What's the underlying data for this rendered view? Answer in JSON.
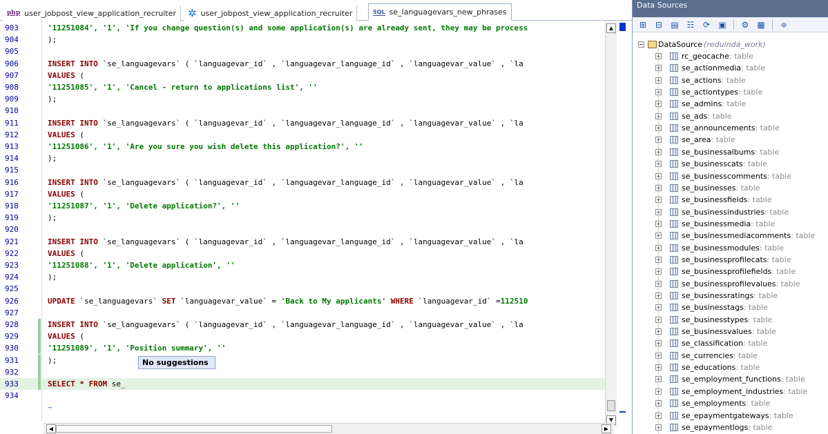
{
  "tabs": [
    {
      "label": "user_jobpost_view_application_recruiter",
      "icon": "php-file-icon",
      "icon_text": "php"
    },
    {
      "label": "user_jobpost_view_application_recruiter",
      "icon": "gear-icon",
      "icon_text": "✲"
    },
    {
      "label": "se_languagevars_new_phrases",
      "icon": "sql-file-icon",
      "icon_text": "SQL"
    }
  ],
  "editor": {
    "lines": [
      {
        "n": "903",
        "tokens": [
          [
            "str",
            "'11251084', '1', 'If you change question(s) and some application(s) are already sent, they may be process"
          ]
        ]
      },
      {
        "n": "904",
        "tokens": [
          [
            "id",
            ");"
          ]
        ]
      },
      {
        "n": "905",
        "tokens": []
      },
      {
        "n": "906",
        "tokens": [
          [
            "kw",
            "INSERT INTO "
          ],
          [
            "id",
            "`se_languagevars` ( `languagevar_id` , `languagevar_language_id` , `languagevar_value` , `la"
          ]
        ]
      },
      {
        "n": "907",
        "tokens": [
          [
            "kw",
            "VALUES "
          ],
          [
            "id",
            "("
          ]
        ]
      },
      {
        "n": "908",
        "tokens": [
          [
            "str",
            "'11251085', '1', 'Cancel - return to applications list', ''"
          ]
        ]
      },
      {
        "n": "909",
        "tokens": [
          [
            "id",
            ");"
          ]
        ]
      },
      {
        "n": "910",
        "tokens": []
      },
      {
        "n": "911",
        "tokens": [
          [
            "kw",
            "INSERT INTO "
          ],
          [
            "id",
            "`se_languagevars` ( `languagevar_id` , `languagevar_language_id` , `languagevar_value` , `la"
          ]
        ]
      },
      {
        "n": "912",
        "tokens": [
          [
            "kw",
            "VALUES "
          ],
          [
            "id",
            "("
          ]
        ]
      },
      {
        "n": "913",
        "tokens": [
          [
            "str",
            "'11251086', '1', 'Are you sure you wish delete this application?', ''"
          ]
        ]
      },
      {
        "n": "914",
        "tokens": [
          [
            "id",
            ");"
          ]
        ]
      },
      {
        "n": "915",
        "tokens": []
      },
      {
        "n": "916",
        "tokens": [
          [
            "kw",
            "INSERT INTO "
          ],
          [
            "id",
            "`se_languagevars` ( `languagevar_id` , `languagevar_language_id` , `languagevar_value` , `la"
          ]
        ]
      },
      {
        "n": "917",
        "tokens": [
          [
            "kw",
            "VALUES "
          ],
          [
            "id",
            "("
          ]
        ]
      },
      {
        "n": "918",
        "tokens": [
          [
            "str",
            "'11251087', '1', 'Delete application?', ''"
          ]
        ]
      },
      {
        "n": "919",
        "tokens": [
          [
            "id",
            ");"
          ]
        ]
      },
      {
        "n": "920",
        "tokens": []
      },
      {
        "n": "921",
        "tokens": [
          [
            "kw",
            "INSERT INTO "
          ],
          [
            "id",
            "`se_languagevars` ( `languagevar_id` , `languagevar_language_id` , `languagevar_value` , `la"
          ]
        ]
      },
      {
        "n": "922",
        "tokens": [
          [
            "kw",
            "VALUES "
          ],
          [
            "id",
            "("
          ]
        ]
      },
      {
        "n": "923",
        "tokens": [
          [
            "str",
            "'11251088', '1', 'Delete application', ''"
          ]
        ]
      },
      {
        "n": "924",
        "tokens": [
          [
            "id",
            ");"
          ]
        ]
      },
      {
        "n": "925",
        "tokens": []
      },
      {
        "n": "926",
        "tokens": [
          [
            "kw",
            "UPDATE "
          ],
          [
            "id",
            "`se_languagevars` "
          ],
          [
            "kw",
            "SET "
          ],
          [
            "id",
            "`languagevar_value` = "
          ],
          [
            "str",
            "'Back to My applicants' "
          ],
          [
            "kw",
            "WHERE "
          ],
          [
            "id",
            "`languagevar_id` ="
          ],
          [
            "str",
            "112510"
          ]
        ]
      },
      {
        "n": "927",
        "tokens": []
      },
      {
        "n": "928",
        "tokens": [
          [
            "kw",
            "INSERT INTO "
          ],
          [
            "id",
            "`se_languagevars` ( `languagevar_id` , `languagevar_language_id` , `languagevar_value` , `la"
          ]
        ],
        "changed": true
      },
      {
        "n": "929",
        "tokens": [
          [
            "kw",
            "VALUES "
          ],
          [
            "id",
            "("
          ]
        ],
        "changed": true
      },
      {
        "n": "930",
        "tokens": [
          [
            "str",
            "'11251089', '1', 'Position summary', ''"
          ]
        ],
        "changed": true
      },
      {
        "n": "931",
        "tokens": [
          [
            "id",
            ");"
          ]
        ],
        "changed": true
      },
      {
        "n": "932",
        "tokens": [],
        "changed": true
      },
      {
        "n": "933",
        "tokens": [
          [
            "kw",
            "SELECT * FROM "
          ],
          [
            "id",
            "se_"
          ]
        ],
        "current": true,
        "changed": true
      },
      {
        "n": "934",
        "tokens": []
      }
    ],
    "end_marker": "~",
    "suggestion_popup": "No suggestions"
  },
  "datasources": {
    "title": "Data Sources",
    "root_name": "DataSource",
    "root_desc": "(reduinda_work)",
    "toolbar_icons": [
      "add-icon",
      "remove-icon",
      "properties-icon",
      "tree-icon",
      "refresh-icon",
      "sql-console-icon",
      "schema-icon",
      "sql-icon",
      "split-icon"
    ],
    "tables": [
      "rc_geocache",
      "se_actionmedia",
      "se_actions",
      "se_actiontypes",
      "se_admins",
      "se_ads",
      "se_announcements",
      "se_area",
      "se_businessalbums",
      "se_businesscats",
      "se_businesscomments",
      "se_businesses",
      "se_businessfields",
      "se_businessindustries",
      "se_businessmedia",
      "se_businessmediacomments",
      "se_businessmodules",
      "se_businessprofilecats",
      "se_businessprofilefields",
      "se_businessprofilevalues",
      "se_businessratings",
      "se_businesstags",
      "se_businesstypes",
      "se_businessvalues",
      "se_classification",
      "se_currencies",
      "se_educations",
      "se_employment_functions",
      "se_employment_industries",
      "se_employments",
      "se_epaymentgateways",
      "se_epaymentlogs"
    ],
    "table_type": ": table"
  }
}
